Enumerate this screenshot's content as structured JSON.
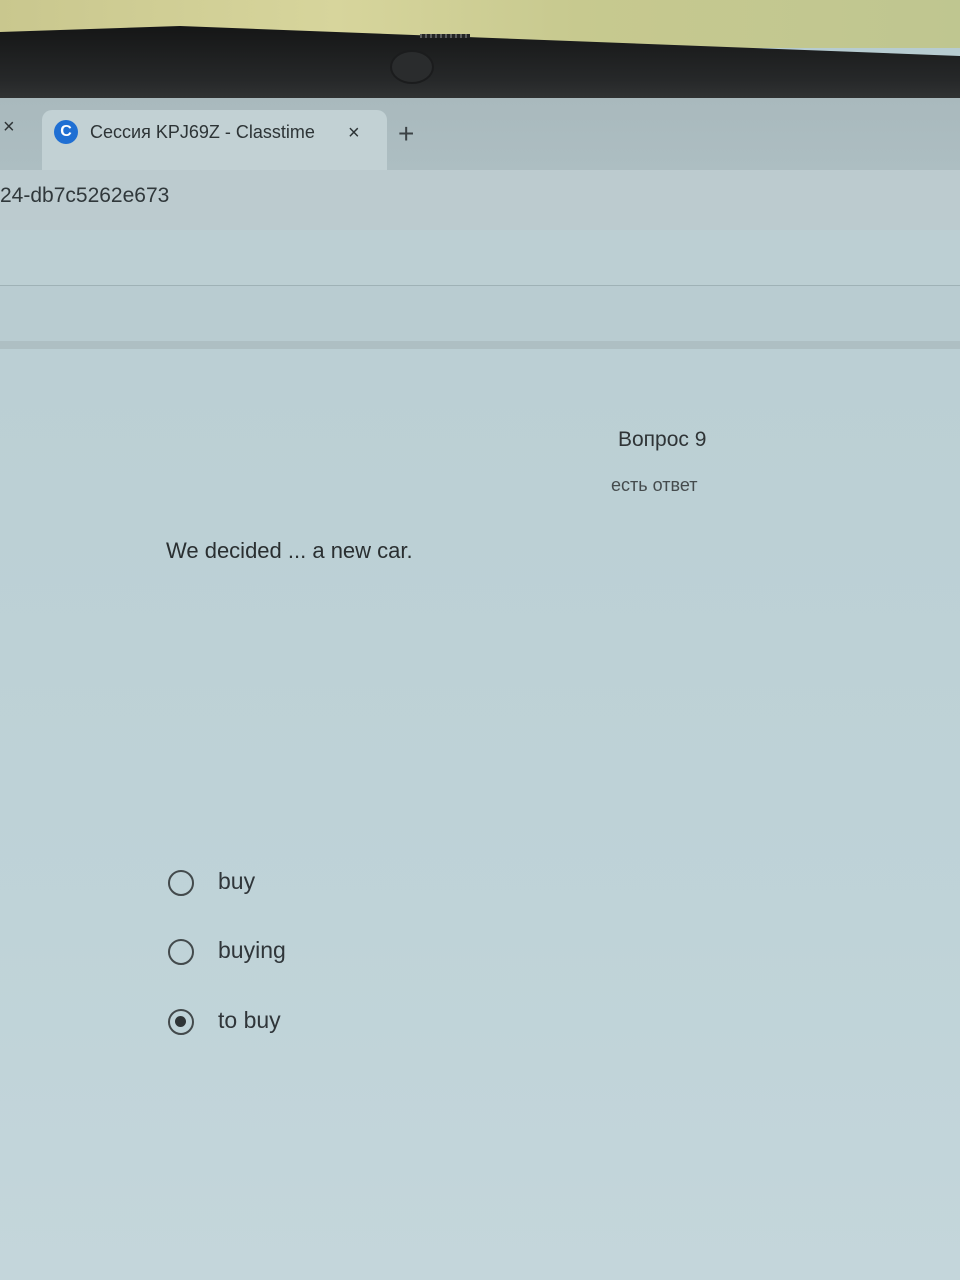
{
  "browser": {
    "prev_tab_close": "×",
    "tab": {
      "favicon_letter": "C",
      "title": "Сессия KPJ69Z - Classtime",
      "close": "×"
    },
    "new_tab": "+",
    "url": "24-db7c5262e673"
  },
  "quiz": {
    "question_number": "Вопрос 9",
    "status": "есть ответ",
    "question": "We decided ... a new car.",
    "options": [
      {
        "label": "buy",
        "selected": false
      },
      {
        "label": "buying",
        "selected": false
      },
      {
        "label": "to buy",
        "selected": true
      }
    ]
  },
  "colors": {
    "screen_bg": "#bccfd4",
    "favicon": "#1f6fd3",
    "text": "#2a2f31"
  }
}
